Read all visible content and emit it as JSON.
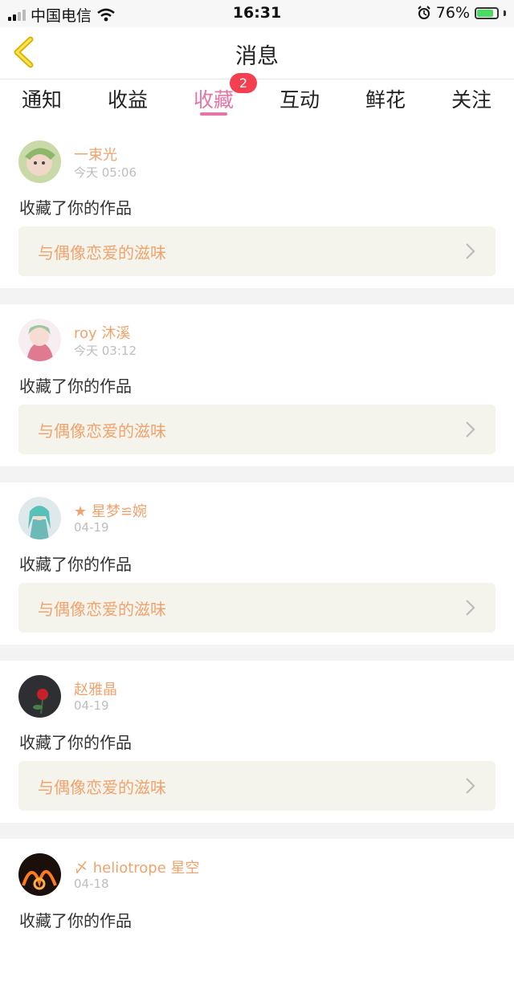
{
  "status_bar": {
    "carrier": "中国电信",
    "time": "16:31",
    "battery": "76%"
  },
  "header": {
    "title": "消息"
  },
  "tabs": {
    "items": [
      {
        "label": "通知"
      },
      {
        "label": "收益"
      },
      {
        "label": "收藏"
      },
      {
        "label": "互动"
      },
      {
        "label": "鲜花"
      },
      {
        "label": "关注"
      }
    ],
    "active_index": 2,
    "badge": "2"
  },
  "notifications": [
    {
      "user": "一束光",
      "time": "今天 05:06",
      "action": "收藏了你的作品",
      "work": "与偶像恋爱的滋味"
    },
    {
      "user": "roy 沐溪",
      "time": "今天 03:12",
      "action": "收藏了你的作品",
      "work": "与偶像恋爱的滋味"
    },
    {
      "user": "★ 星梦≌婉",
      "time": "04-19",
      "action": "收藏了你的作品",
      "work": "与偶像恋爱的滋味"
    },
    {
      "user": "赵雅晶",
      "time": "04-19",
      "action": "收藏了你的作品",
      "work": "与偶像恋爱的滋味"
    },
    {
      "user": "〆 heliotrope 星空",
      "time": "04-18",
      "action": "收藏了你的作品",
      "work": ""
    }
  ],
  "colors": {
    "accent": "#e774a6",
    "username": "#f0a36d",
    "badge": "#f33f4f",
    "work_bg": "#f4f4ec"
  }
}
